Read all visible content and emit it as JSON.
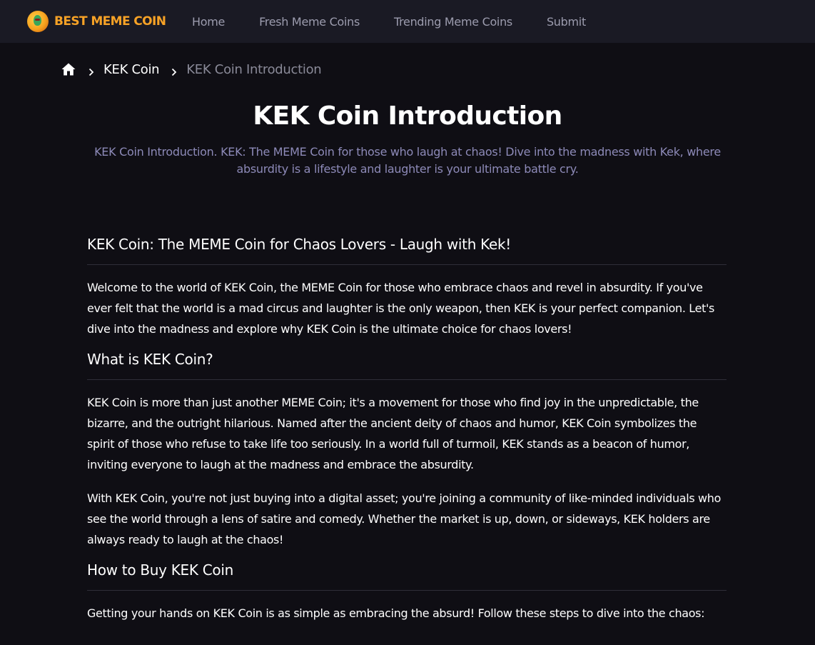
{
  "brand": {
    "name": "BEST MEME COIN",
    "logo_icon": "coin-frog-logo-icon",
    "accent": "#f7a226"
  },
  "nav": {
    "items": [
      {
        "label": "Home"
      },
      {
        "label": "Fresh Meme Coins"
      },
      {
        "label": "Trending Meme Coins"
      },
      {
        "label": "Submit"
      }
    ]
  },
  "breadcrumb": {
    "home_icon": "home-icon",
    "separator_icon": "chevron-right-icon",
    "parent": "KEK Coin",
    "current": "KEK Coin Introduction"
  },
  "page": {
    "title": "KEK Coin Introduction",
    "intro": "KEK Coin Introduction. KEK: The MEME Coin for those who laugh at chaos! Dive into the madness with Kek, where absurdity is a lifestyle and laughter is your ultimate battle cry."
  },
  "article": {
    "sections": [
      {
        "heading": "KEK Coin: The MEME Coin for Chaos Lovers - Laugh with Kek!",
        "paragraphs": [
          "Welcome to the world of KEK Coin, the MEME Coin for those who embrace chaos and revel in absurdity. If you've ever felt that the world is a mad circus and laughter is the only weapon, then KEK is your perfect companion. Let's dive into the madness and explore why KEK Coin is the ultimate choice for chaos lovers!"
        ]
      },
      {
        "heading": "What is KEK Coin?",
        "paragraphs": [
          "KEK Coin is more than just another MEME Coin; it's a movement for those who find joy in the unpredictable, the bizarre, and the outright hilarious. Named after the ancient deity of chaos and humor, KEK Coin symbolizes the spirit of those who refuse to take life too seriously. In a world full of turmoil, KEK stands as a beacon of humor, inviting everyone to laugh at the madness and embrace the absurdity.",
          "With KEK Coin, you're not just buying into a digital asset; you're joining a community of like-minded individuals who see the world through a lens of satire and comedy. Whether the market is up, down, or sideways, KEK holders are always ready to laugh at the chaos!"
        ]
      },
      {
        "heading": "How to Buy KEK Coin",
        "paragraphs": [
          "Getting your hands on KEK Coin is as simple as embracing the absurd! Follow these steps to dive into the chaos:"
        ]
      }
    ]
  }
}
